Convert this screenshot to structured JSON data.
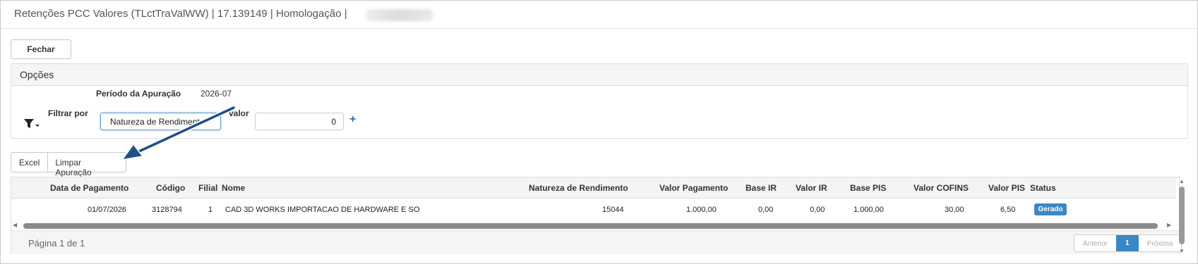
{
  "window": {
    "title": "Retenções PCC Valores (TLctTraValWW) | 17.139149 | Homologação |"
  },
  "toolbar": {
    "fechar_label": "Fechar"
  },
  "opcoes": {
    "title": "Opções",
    "periodo_label": "Período da Apuração",
    "periodo_value": "2026-07",
    "filtrar_label": "Filtrar por",
    "filtro_selected": "Natureza de Rendimento",
    "valor_label": "valor",
    "valor_value": "0"
  },
  "actions": {
    "excel_label": "Excel",
    "limpar_label": "Limpar Apuração"
  },
  "grid": {
    "headers": [
      "Data de Pagamento",
      "Código",
      "Filial",
      "Nome",
      "Natureza de Rendimento",
      "Valor Pagamento",
      "Base IR",
      "Valor IR",
      "Base PIS",
      "Valor COFINS",
      "Valor PIS",
      "Status"
    ],
    "rows": [
      {
        "data": "01/07/2026",
        "codigo": "3128794",
        "filial": "1",
        "nome": "CAD 3D WORKS IMPORTACAO DE HARDWARE E SO",
        "natureza": "15044",
        "valor_pagamento": "1.000,00",
        "base_ir": "0,00",
        "valor_ir": "0,00",
        "base_pis": "1.000,00",
        "valor_cofins": "30,00",
        "valor_pis": "6,50",
        "status": "Gerado"
      }
    ]
  },
  "footer": {
    "page_info": "Página 1 de 1",
    "anterior": "Anterior",
    "current_page": "1",
    "proxima": "Próxima"
  },
  "colors": {
    "accent": "#3a87c6",
    "annotation_arrow": "#1f4f8a"
  },
  "icons": {
    "filter": "filter-dropdown-icon",
    "add": "plus-icon"
  }
}
